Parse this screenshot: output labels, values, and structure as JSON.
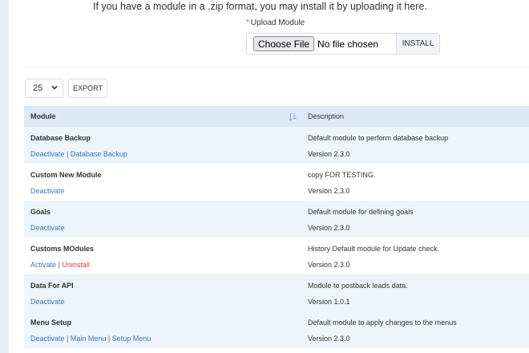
{
  "upload": {
    "intro": "If you have a module in a .zip format, you may install it by uploading it here.",
    "required_mark": "*",
    "label": "Upload Module",
    "choose_button": "Choose File",
    "file_status": "No file chosen",
    "install_button": "INSTALL"
  },
  "toolbar": {
    "page_size": "25",
    "export_label": "EXPORT"
  },
  "table": {
    "headers": {
      "module": "Module",
      "description": "Description"
    },
    "rows": [
      {
        "name": "Database Backup",
        "actions": [
          {
            "label": "Deactivate"
          },
          {
            "label": "Database Backup"
          }
        ],
        "description": "Default module to perform database backup",
        "version": "Version 2.3.0"
      },
      {
        "name": "Custom New Module",
        "actions": [
          {
            "label": "Deactivate"
          }
        ],
        "description": "copy FOR TESTING.",
        "version": "Version 2.3.0"
      },
      {
        "name": "Goals",
        "actions": [
          {
            "label": "Deactivate"
          }
        ],
        "description": "Default module for defining goals",
        "version": "Version 2.3.0"
      },
      {
        "name": "Customs MOdules",
        "actions": [
          {
            "label": "Activate"
          },
          {
            "label": "Uninstall"
          }
        ],
        "description": "History Default module for Update check.",
        "version": "Version 2.3.0"
      },
      {
        "name": "Data For API",
        "actions": [
          {
            "label": "Deactivate"
          }
        ],
        "description": "Module to postback leads data.",
        "version": "Version 1.0.1"
      },
      {
        "name": "Menu Setup",
        "actions": [
          {
            "label": "Deactivate"
          },
          {
            "label": "Main Menu"
          },
          {
            "label": "Setup Menu"
          }
        ],
        "description": "Default module to apply changes to the menus",
        "version": "Version 2.3.0"
      }
    ]
  },
  "colors": {
    "link": "#3b7ac0",
    "danger": "#e03e3e",
    "header_bg": "#dde9f6",
    "row_alt_bg": "#edf4fb"
  }
}
